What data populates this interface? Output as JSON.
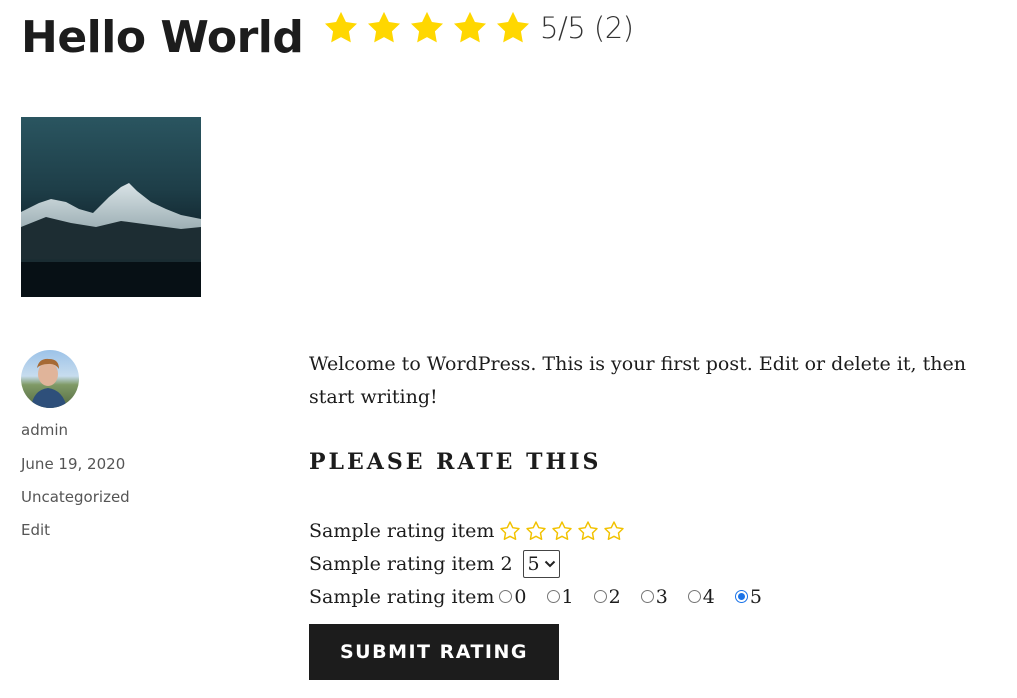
{
  "post": {
    "title": "Hello World",
    "intro": "Welcome to WordPress. This is your first post. Edit or delete it, then start writing!"
  },
  "aggregate_rating": {
    "stars_filled": 5,
    "stars_total": 5,
    "text": "5/5 (2)",
    "star_color": "#ffd700"
  },
  "meta": {
    "author": "admin",
    "date": "June 19, 2020",
    "category": "Uncategorized",
    "edit": "Edit"
  },
  "rating_form": {
    "heading": "PLEASE RATE THIS",
    "item1": {
      "label": "Sample rating item",
      "stars_selected": 0,
      "stars_total": 5
    },
    "item2": {
      "label": "Sample rating item 2",
      "selected": "5"
    },
    "item3": {
      "label": "Sample rating item",
      "options": [
        "0",
        "1",
        "2",
        "3",
        "4",
        "5"
      ],
      "selected": "5"
    },
    "submit_label": "SUBMIT RATING"
  },
  "colors": {
    "text": "#1c1c1c",
    "button_bg": "#1c1c1c",
    "star": "#ffd700",
    "radio_checked": "#1a73e8"
  },
  "icons": {
    "rating_star": "star-icon",
    "empty_star": "star-outline-icon",
    "select_arrow": "chevron-down-icon"
  }
}
